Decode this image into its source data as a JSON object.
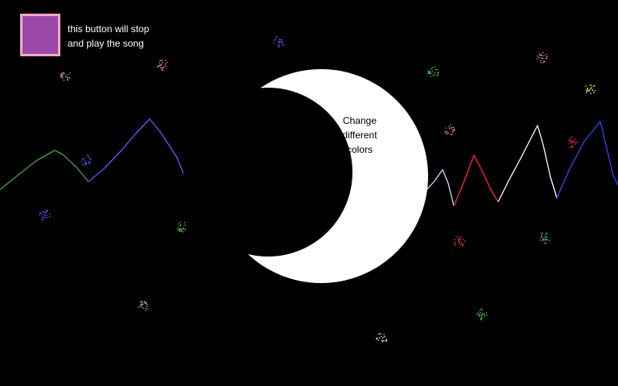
{
  "play_button": {
    "caption_lines": [
      "this button will stop",
      "and play the song"
    ],
    "fill_color": "#9a49a8",
    "border_color": "#f4a7c8"
  },
  "moon": {
    "caption_lines": [
      "Change",
      "different",
      "colors"
    ],
    "color": "#ffffff"
  },
  "background_color": "#000000",
  "mountain_segment_colors": [
    "#3aa63a",
    "#5560ff",
    "#ff9a8a",
    "#ff7a55",
    "#bfe8ff",
    "#ff2b2b",
    "#ffffff",
    "#3344ff"
  ],
  "star_colors": [
    "#ff9fb0",
    "#5566ff",
    "#ff8899",
    "#55dd66",
    "#ff3344",
    "#ccddff",
    "#88eeff",
    "#ffff66"
  ]
}
